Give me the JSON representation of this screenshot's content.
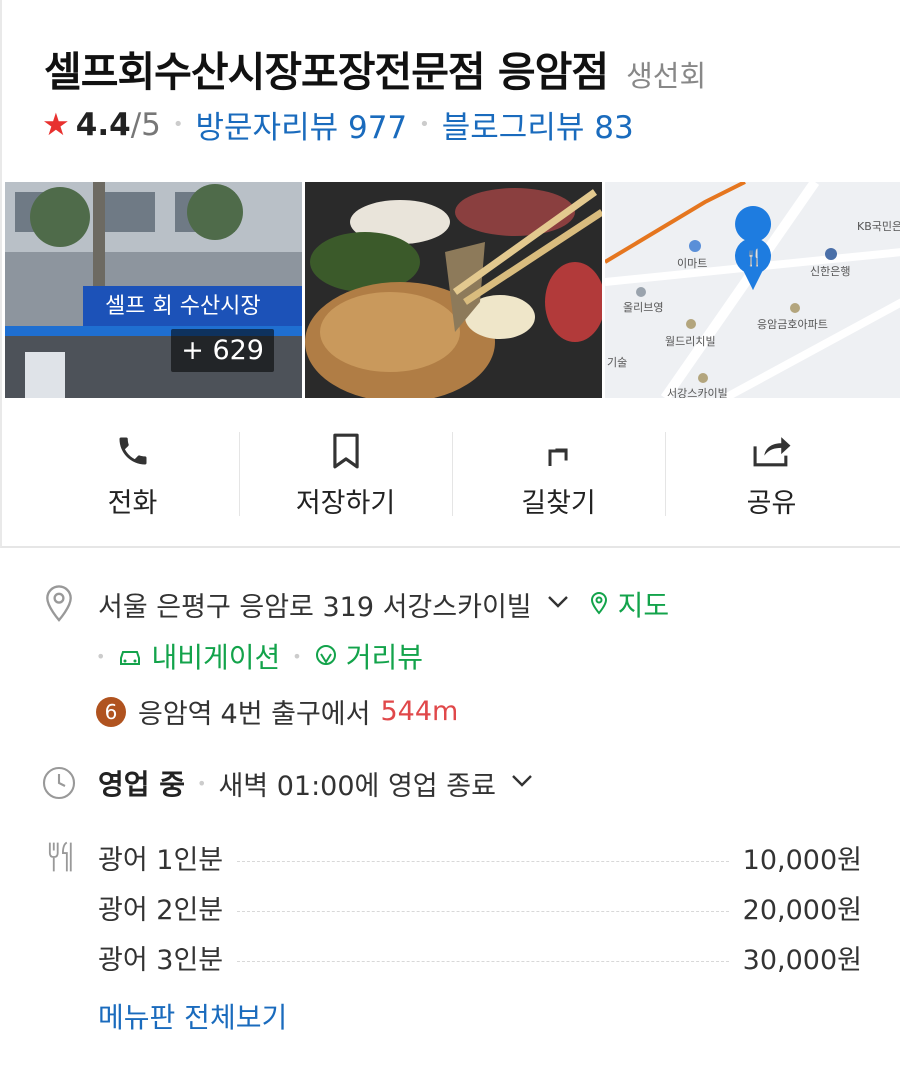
{
  "header": {
    "title": "셀프회수산시장포장전문점 응암점",
    "category": "생선회",
    "rating": "4.4",
    "rating_max": "/5",
    "visitor_reviews": "방문자리뷰 977",
    "blog_reviews": "블로그리뷰 83"
  },
  "photos": {
    "more_count": "+ 629",
    "sign_text": "셀프 회 수산시장",
    "map_labels": [
      "KB국민은",
      "이마트",
      "신한은행",
      "올리브영",
      "응암금호아파트",
      "월드리치빌",
      "서강스카이빌",
      "기술"
    ]
  },
  "actions": [
    {
      "label": "전화",
      "icon": "phone-icon"
    },
    {
      "label": "저장하기",
      "icon": "bookmark-icon"
    },
    {
      "label": "길찾기",
      "icon": "directions-icon"
    },
    {
      "label": "공유",
      "icon": "share-icon"
    }
  ],
  "address": {
    "text": "서울 은평구 응암로 319 서강스카이빌",
    "map_link": "지도",
    "navigation_link": "내비게이션",
    "streetview_link": "거리뷰"
  },
  "subway": {
    "line": "6",
    "station": "응암역",
    "exit_text": "4번 출구에서",
    "distance": "544m"
  },
  "hours": {
    "status": "영업 중",
    "detail": "새벽 01:00에 영업 종료"
  },
  "menu": {
    "items": [
      {
        "name": "광어 1인분",
        "price": "10,000원"
      },
      {
        "name": "광어 2인분",
        "price": "20,000원"
      },
      {
        "name": "광어 3인분",
        "price": "30,000원"
      }
    ],
    "view_all": "메뉴판 전체보기"
  },
  "colors": {
    "accent_blue": "#1a6bbd",
    "accent_green": "#13a34b",
    "star_red": "#e8312f",
    "distance_red": "#e0484a",
    "metro_line6": "#b0531f"
  }
}
